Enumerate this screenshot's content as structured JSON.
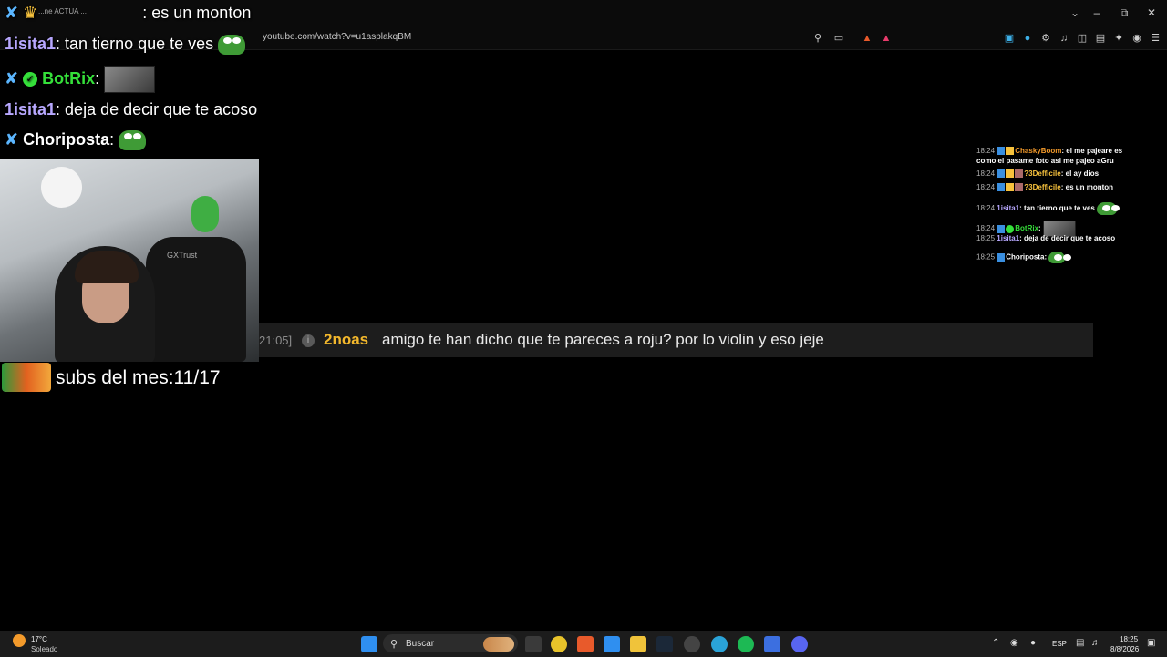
{
  "browser": {
    "tab_title": "...ne ACTUA ... ",
    "url": "youtube.com/watch?v=u1asplakqBM",
    "window_controls": [
      "chevron-down-icon",
      "minimize-icon",
      "restore-icon",
      "close-icon"
    ]
  },
  "overlay_chat": [
    {
      "user": "",
      "text": ": es un monton"
    },
    {
      "user": "1isita1",
      "text": ": tan tierno que te ves"
    },
    {
      "user": "BotRix",
      "text": ":"
    },
    {
      "user": "1isita1",
      "text": ": deja de decir que te acoso"
    },
    {
      "user": "Choriposta",
      "text": ":"
    }
  ],
  "webcam": {
    "chair_brand": "GXTrust"
  },
  "subs": {
    "label": "subs del mes:11/17"
  },
  "highlight": {
    "time": "21:05]",
    "user": "2noas",
    "message": "amigo te han dicho que te pareces a roju? por lo violin y eso jeje"
  },
  "side_chat": [
    {
      "time": "18:24",
      "user": "ChaskyBoom",
      "text": ": el me pajeare es"
    },
    {
      "time": "",
      "user": "",
      "text": "como el pasame foto asi me pajeo aGru"
    },
    {
      "time": "18:24",
      "user": "?3Defficile",
      "text": ": el ay dios"
    },
    {
      "time": "18:24",
      "user": "?3Defficile",
      "text": ": es un monton"
    },
    {
      "time": "18:24",
      "user": "1isita1",
      "text": ": tan tierno que te ves"
    },
    {
      "time": "18:24",
      "user": "BotRix",
      "text": ":"
    },
    {
      "time": "18:25",
      "user": "1isita1",
      "text": ": deja de decir que te acoso"
    },
    {
      "time": "18:25",
      "user": "Choriposta",
      "text": ":"
    }
  ],
  "taskbar": {
    "weather_temp": "17°C",
    "weather_desc": "Soleado",
    "search_label": "Buscar",
    "language": "ESP",
    "time": "18:25",
    "date": "8/8/2026"
  }
}
